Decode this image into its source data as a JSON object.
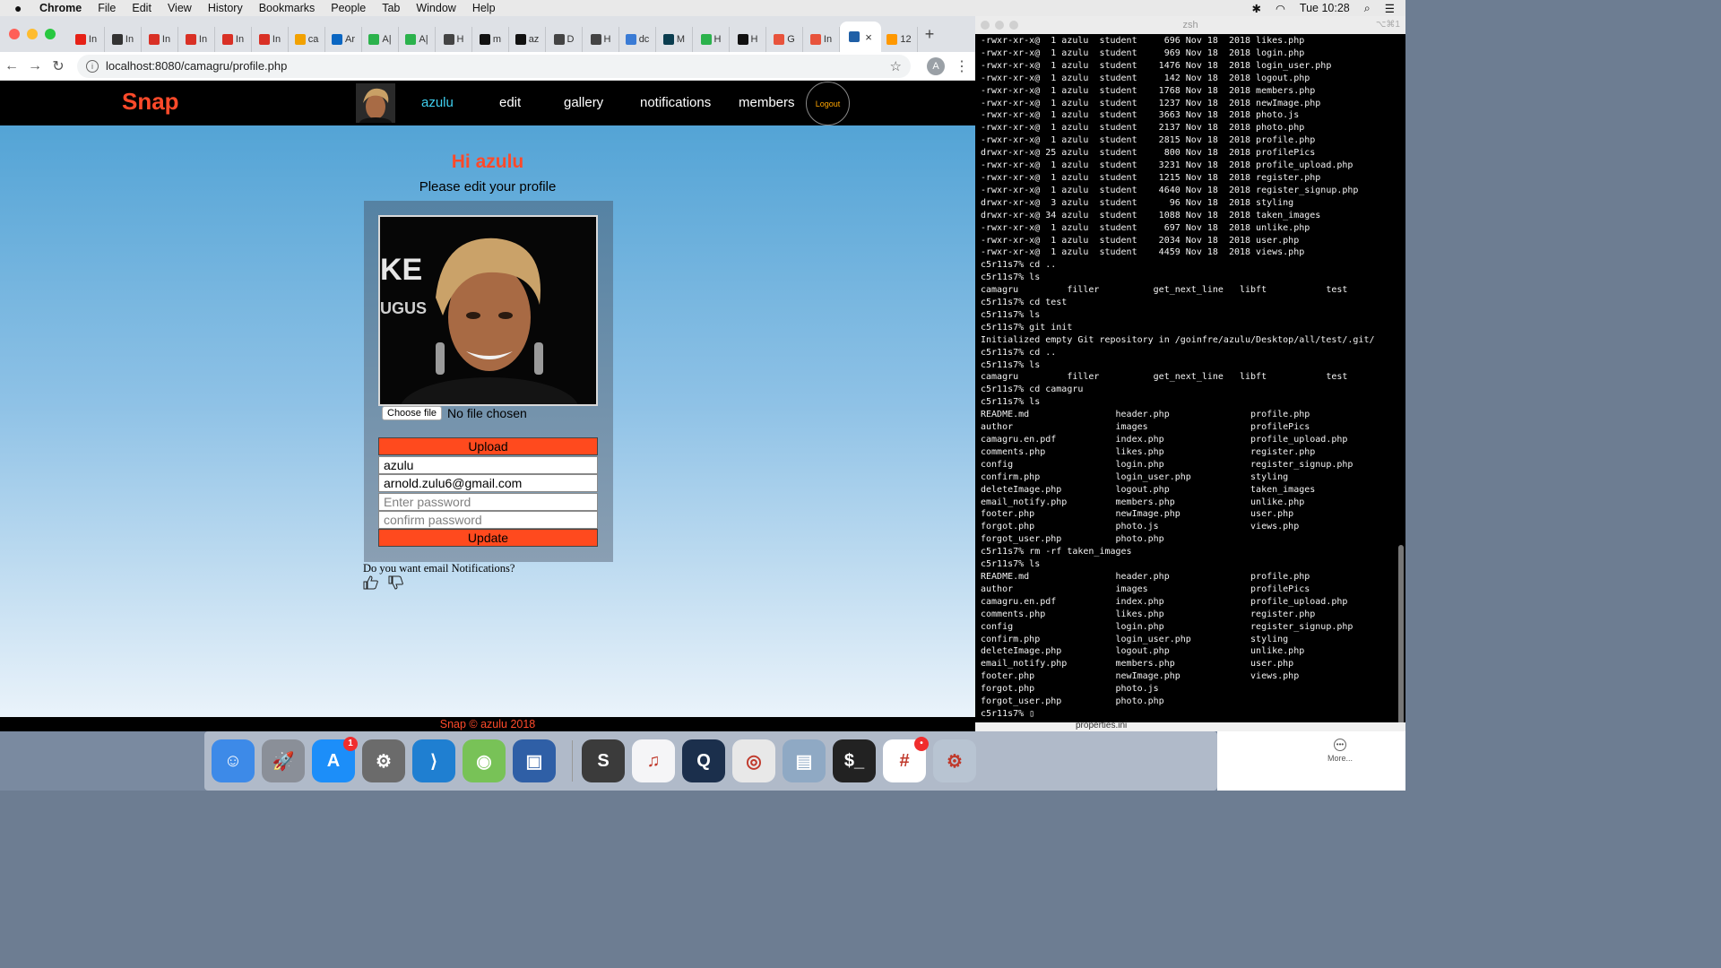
{
  "menubar": {
    "app": "Chrome",
    "items": [
      "File",
      "Edit",
      "View",
      "History",
      "Bookmarks",
      "People",
      "Tab",
      "Window",
      "Help"
    ],
    "clock": "Tue 10:28"
  },
  "browser": {
    "tabs": [
      {
        "label": "In",
        "color": "#e62117"
      },
      {
        "label": "In",
        "color": "#333333"
      },
      {
        "label": "In",
        "color": "#d93025"
      },
      {
        "label": "In",
        "color": "#d93025"
      },
      {
        "label": "In",
        "color": "#d93025"
      },
      {
        "label": "In",
        "color": "#d93025"
      },
      {
        "label": "ca",
        "color": "#f2a100"
      },
      {
        "label": "Ar",
        "color": "#0a66c2"
      },
      {
        "label": "A|",
        "color": "#2bb24c"
      },
      {
        "label": "A|",
        "color": "#2bb24c"
      },
      {
        "label": "H",
        "color": "#444444"
      },
      {
        "label": "m",
        "color": "#111111"
      },
      {
        "label": "az",
        "color": "#111111"
      },
      {
        "label": "D",
        "color": "#444444"
      },
      {
        "label": "H",
        "color": "#444444"
      },
      {
        "label": "dc",
        "color": "#3a7bd5"
      },
      {
        "label": "M",
        "color": "#0b3d4f"
      },
      {
        "label": "H",
        "color": "#2bb24c"
      },
      {
        "label": "H",
        "color": "#111111"
      },
      {
        "label": "G",
        "color": "#e8533c"
      },
      {
        "label": "In",
        "color": "#e8533c"
      },
      {
        "label": "",
        "color": "#1f5fa6"
      },
      {
        "label": "12",
        "color": "#ff9800"
      }
    ],
    "url": "localhost:8080/camagru/profile.php",
    "profile_initial": "A"
  },
  "site": {
    "brand": "Snap",
    "nav": {
      "user": "azulu",
      "edit": "edit",
      "gallery": "gallery",
      "notifications": "notifications",
      "members": "members",
      "logout": "Logout"
    },
    "greeting": "Hi azulu",
    "subtitle": "Please edit your profile",
    "file": {
      "button": "Choose file",
      "status": "No file chosen"
    },
    "upload_label": "Upload",
    "username_value": "azulu",
    "email_value": "arnold.zulu6@gmail.com",
    "password_placeholder": "Enter password",
    "confirm_placeholder": "confirm password",
    "update_label": "Update",
    "notify_question": "Do you want email Notifications?",
    "footer": "Snap © azulu 2018"
  },
  "terminal": {
    "title": "zsh",
    "shortcut": "⌥⌘1",
    "lines": [
      "-rwxr-xr-x@  1 azulu  student     696 Nov 18  2018 likes.php",
      "-rwxr-xr-x@  1 azulu  student     969 Nov 18  2018 login.php",
      "-rwxr-xr-x@  1 azulu  student    1476 Nov 18  2018 login_user.php",
      "-rwxr-xr-x@  1 azulu  student     142 Nov 18  2018 logout.php",
      "-rwxr-xr-x@  1 azulu  student    1768 Nov 18  2018 members.php",
      "-rwxr-xr-x@  1 azulu  student    1237 Nov 18  2018 newImage.php",
      "-rwxr-xr-x@  1 azulu  student    3663 Nov 18  2018 photo.js",
      "-rwxr-xr-x@  1 azulu  student    2137 Nov 18  2018 photo.php",
      "-rwxr-xr-x@  1 azulu  student    2815 Nov 18  2018 profile.php",
      "drwxr-xr-x@ 25 azulu  student     800 Nov 18  2018 profilePics",
      "-rwxr-xr-x@  1 azulu  student    3231 Nov 18  2018 profile_upload.php",
      "-rwxr-xr-x@  1 azulu  student    1215 Nov 18  2018 register.php",
      "-rwxr-xr-x@  1 azulu  student    4640 Nov 18  2018 register_signup.php",
      "drwxr-xr-x@  3 azulu  student      96 Nov 18  2018 styling",
      "drwxr-xr-x@ 34 azulu  student    1088 Nov 18  2018 taken_images",
      "-rwxr-xr-x@  1 azulu  student     697 Nov 18  2018 unlike.php",
      "-rwxr-xr-x@  1 azulu  student    2034 Nov 18  2018 user.php",
      "-rwxr-xr-x@  1 azulu  student    4459 Nov 18  2018 views.php",
      "c5r11s7% cd ..",
      "c5r11s7% ls",
      "camagru         filler          get_next_line   libft           test",
      "c5r11s7% cd test",
      "c5r11s7% ls",
      "c5r11s7% git init",
      "Initialized empty Git repository in /goinfre/azulu/Desktop/all/test/.git/",
      "c5r11s7% cd ..",
      "c5r11s7% ls",
      "camagru         filler          get_next_line   libft           test",
      "c5r11s7% cd camagru",
      "c5r11s7% ls",
      "README.md                header.php               profile.php",
      "author                   images                   profilePics",
      "camagru.en.pdf           index.php                profile_upload.php",
      "comments.php             likes.php                register.php",
      "config                   login.php                register_signup.php",
      "confirm.php              login_user.php           styling",
      "deleteImage.php          logout.php               taken_images",
      "email_notify.php         members.php              unlike.php",
      "footer.php               newImage.php             user.php",
      "forgot.php               photo.js                 views.php",
      "forgot_user.php          photo.php",
      "c5r11s7% rm -rf taken_images",
      "c5r11s7% ls",
      "README.md                header.php               profile.php",
      "author                   images                   profilePics",
      "camagru.en.pdf           index.php                profile_upload.php",
      "comments.php             likes.php                register.php",
      "config                   login.php                register_signup.php",
      "confirm.php              login_user.php           styling",
      "deleteImage.php          logout.php               unlike.php",
      "email_notify.php         members.php              user.php",
      "footer.php               newImage.php             views.php",
      "forgot.php               photo.js",
      "forgot_user.php          photo.php",
      "c5r11s7% ▯"
    ],
    "finder_peek": "properties.ini"
  },
  "dock": {
    "items": [
      {
        "name": "finder-icon",
        "color": "#3d8ae8",
        "glyph": "☺"
      },
      {
        "name": "launchpad-icon",
        "color": "#8a8f98",
        "glyph": "🚀"
      },
      {
        "name": "app-store-icon",
        "color": "#1c8ef9",
        "glyph": "A",
        "badge": "1"
      },
      {
        "name": "system-preferences-icon",
        "color": "#6b6b6b",
        "glyph": "⚙"
      },
      {
        "name": "vscode-icon",
        "color": "#1f7fd1",
        "glyph": "⟩"
      },
      {
        "name": "android-studio-icon",
        "color": "#78c257",
        "glyph": "◉"
      },
      {
        "name": "virtualbox-icon",
        "color": "#2f5fa6",
        "glyph": "▣"
      },
      {
        "name": "sublime-text-icon",
        "color": "#3b3b3b",
        "glyph": "S"
      },
      {
        "name": "itunes-icon",
        "color": "#f5f5f7",
        "glyph": "♫"
      },
      {
        "name": "quicktime-icon",
        "color": "#1b2f4c",
        "glyph": "Q"
      },
      {
        "name": "chrome-icon",
        "color": "#e8e8e8",
        "glyph": "◎"
      },
      {
        "name": "preview-icon",
        "color": "#8fa9c4",
        "glyph": "▤"
      },
      {
        "name": "terminal-icon",
        "color": "#222222",
        "glyph": "$_"
      },
      {
        "name": "slack-icon",
        "color": "#ffffff",
        "glyph": "#",
        "badge": "•"
      },
      {
        "name": "settings-gear-icon",
        "color": "#b8c4d2",
        "glyph": "⚙"
      }
    ],
    "more_label": "More..."
  }
}
